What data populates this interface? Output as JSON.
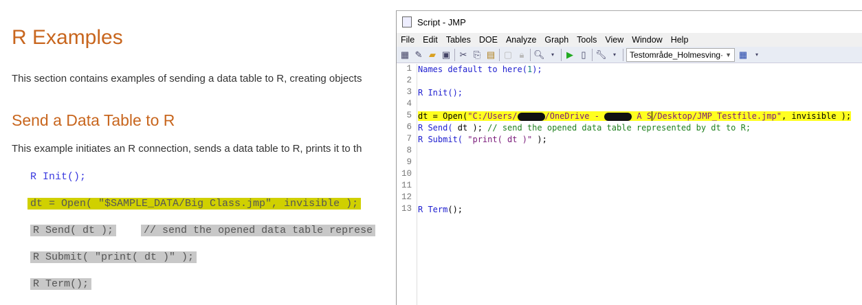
{
  "doc": {
    "title": "R Examples",
    "intro": "This section contains examples of sending a data table to R, creating objects",
    "section_title": "Send a Data Table to R",
    "section_text": "This example initiates an R connection, sends a data table to R, prints it to th",
    "code": {
      "l1_kw": "R",
      "l1": " Init();",
      "l2": "dt = Open( \"$SAMPLE_DATA/Big Class.jmp\", invisible );",
      "l3": "R Send( dt );",
      "l3c": "// send the opened data table represe",
      "l4": "R Submit( \"print( dt )\" );",
      "l5": "R Term();"
    }
  },
  "window": {
    "title": "Script - JMP",
    "menu": [
      "File",
      "Edit",
      "Tables",
      "DOE",
      "Analyze",
      "Graph",
      "Tools",
      "View",
      "Window",
      "Help"
    ],
    "combo_value": "Testområde_Holmesving·",
    "line_numbers": [
      "1",
      "2",
      "3",
      "4",
      "5",
      "6",
      "7",
      "8",
      "9",
      "10",
      "11",
      "12",
      "13"
    ],
    "code": {
      "l1a": "Names default to here(",
      "l1n": "1",
      "l1b": ");",
      "l3": "R Init();",
      "l5a": "dt = Open(",
      "l5b": "\"C:/Users/",
      "l5c": "/OneDrive - ",
      "l5d": " A S",
      "l5e": "/Desktop/JMP_Testfile.jmp\"",
      "l5f": ", invisible );",
      "l6a": "R Send(",
      "l6b": " dt ); ",
      "l6c": "// send the opened data table represented by dt to R;",
      "l7a": "R Submit(",
      "l7b": " \"print( dt )\"",
      "l7c": " );",
      "l13a": "R Term",
      "l13b": "();"
    }
  }
}
